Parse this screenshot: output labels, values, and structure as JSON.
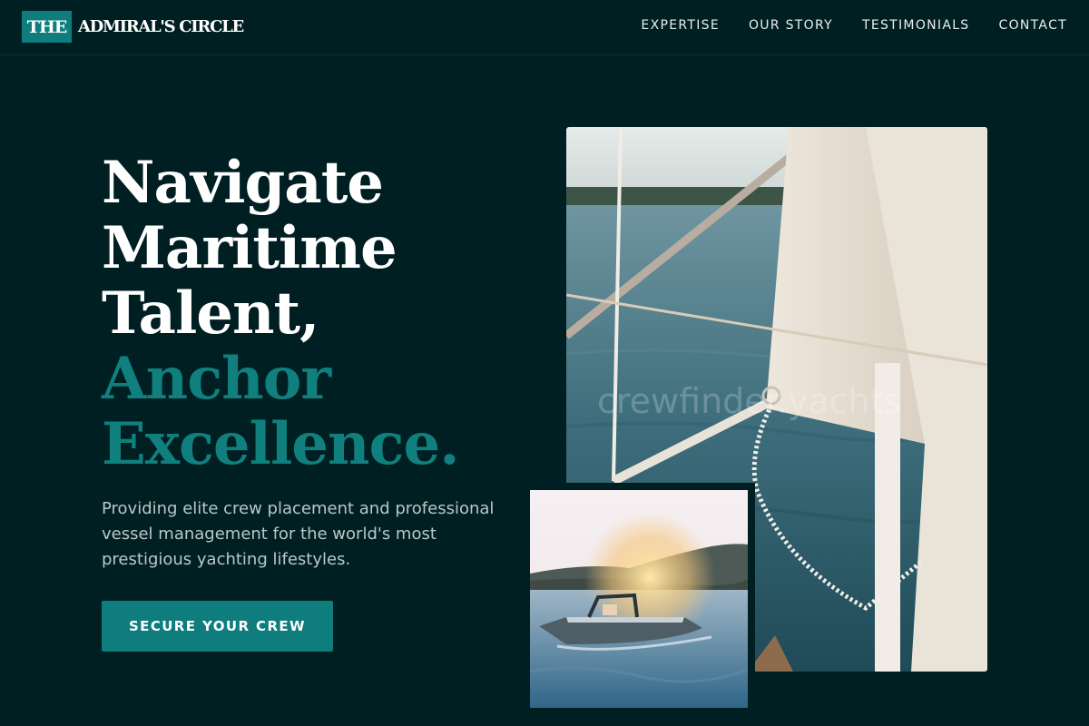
{
  "brand": {
    "badge": "THE",
    "name": "ADMIRAL'S CIRCLE"
  },
  "nav": {
    "items": [
      {
        "label": "EXPERTISE"
      },
      {
        "label": "OUR STORY"
      },
      {
        "label": "TESTIMONIALS"
      },
      {
        "label": "CONTACT"
      }
    ]
  },
  "hero": {
    "lines_white": [
      "Navigate",
      "Maritime",
      "Talent,"
    ],
    "lines_accent": [
      "Anchor",
      "Excellence."
    ],
    "description": "Providing elite crew placement and professional vessel management for the world's most prestigious yachting lifestyles.",
    "cta_label": "SECURE YOUR CREW"
  },
  "images": {
    "main_watermark": "crewfinder.yachts"
  },
  "colors": {
    "background": "#001f22",
    "accent": "#0f7c7e",
    "text": "#ffffff",
    "muted_text": "#b9c8c8"
  }
}
